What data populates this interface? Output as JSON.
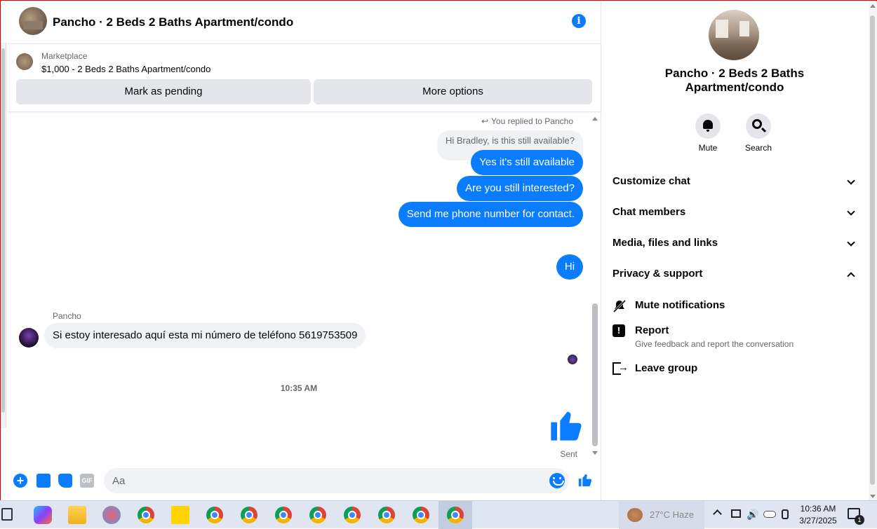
{
  "header": {
    "title": "Pancho · 2 Beds 2 Baths Apartment/condo",
    "info_icon": "info-icon"
  },
  "marketplace": {
    "label": "Marketplace",
    "listing": "$1,000 - 2 Beds 2 Baths Apartment/condo",
    "pending_button": "Mark as pending",
    "more_button": "More options"
  },
  "messages": {
    "reply_notice": "You replied to Pancho",
    "quoted": "Hi Bradley, is this still available?",
    "outgoing": [
      "Yes it's still available",
      "Are you still interested?",
      "Send me phone number for contact.",
      "Hi"
    ],
    "sender_name": "Pancho",
    "incoming": "Si estoy interesado  aquí esta mi número  de teléfono 5619753509",
    "timestamp": "10:35 AM",
    "status": "Sent"
  },
  "composer": {
    "placeholder": "Aa",
    "gif_label": "GIF"
  },
  "info_panel": {
    "name": "Pancho · 2 Beds 2 Baths Apartment/condo",
    "mute_label": "Mute",
    "search_label": "Search",
    "sections": [
      "Customize chat",
      "Chat members",
      "Media, files and links",
      "Privacy & support"
    ],
    "mute_notifications": "Mute notifications",
    "report": "Report",
    "report_desc": "Give feedback and report the conversation",
    "leave_group": "Leave group"
  },
  "taskbar": {
    "weather": "27°C  Haze",
    "time": "10:36 AM",
    "date": "3/27/2025",
    "notification_count": "1"
  },
  "colors": {
    "accent": "#0a7cff",
    "bubble_in": "#f0f2f5",
    "secondary_text": "#65676b"
  }
}
